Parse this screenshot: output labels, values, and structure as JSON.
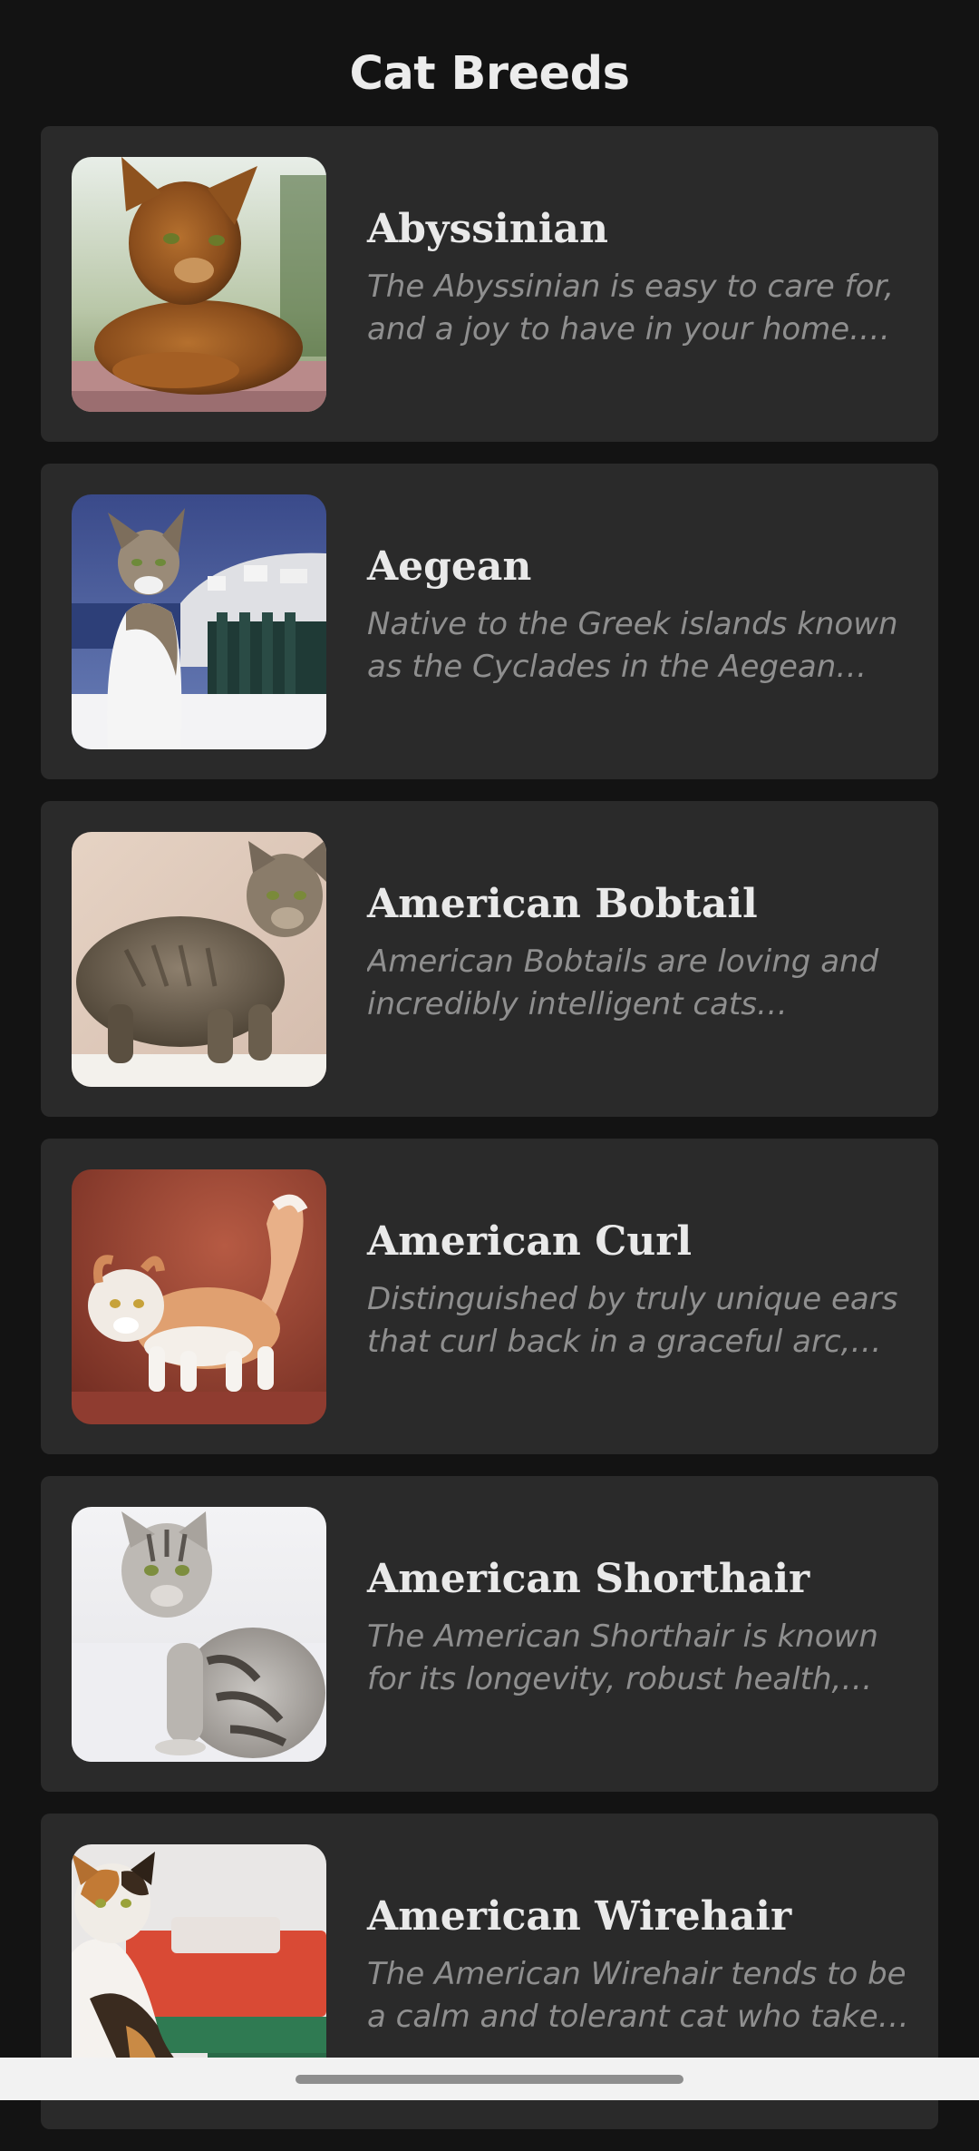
{
  "app": {
    "title": "Cat Breeds"
  },
  "breeds": [
    {
      "name": "Abyssinian",
      "description": "The Abyssinian is easy to care for, and a joy to have in your home. They’re affectionate cats and love both people and other animals.",
      "image": "abyssinian-cat-photo"
    },
    {
      "name": "Aegean",
      "description": "Native to the Greek islands known as the Cyclades in the Aegean Sea, these are natural cats, meaning they developed without humans getting involved.",
      "image": "aegean-cat-photo"
    },
    {
      "name": "American Bobtail",
      "description": "American Bobtails are loving and incredibly intelligent cats possessing a distinctive wild appearance.",
      "image": "american-bobtail-cat-photo"
    },
    {
      "name": "American Curl",
      "description": "Distinguished by truly unique ears that curl back in a graceful arc, offering an alert, perky, happily surprised expression.",
      "image": "american-curl-cat-photo"
    },
    {
      "name": "American Shorthair",
      "description": "The American Shorthair is known for its longevity, robust health, good looks, sweet personality, and amiability with children.",
      "image": "american-shorthair-cat-photo"
    },
    {
      "name": "American Wirehair",
      "description": "The American Wirehair tends to be a calm and tolerant cat who takes life as it comes.",
      "image": "american-wirehair-cat-photo"
    }
  ],
  "colors": {
    "background": "#131313",
    "card": "#2a2a2a",
    "title_text": "#ececec",
    "name_text": "#e9e9e9",
    "description_text": "#8f8f8f",
    "nav_bar": "#f2f2f2"
  }
}
